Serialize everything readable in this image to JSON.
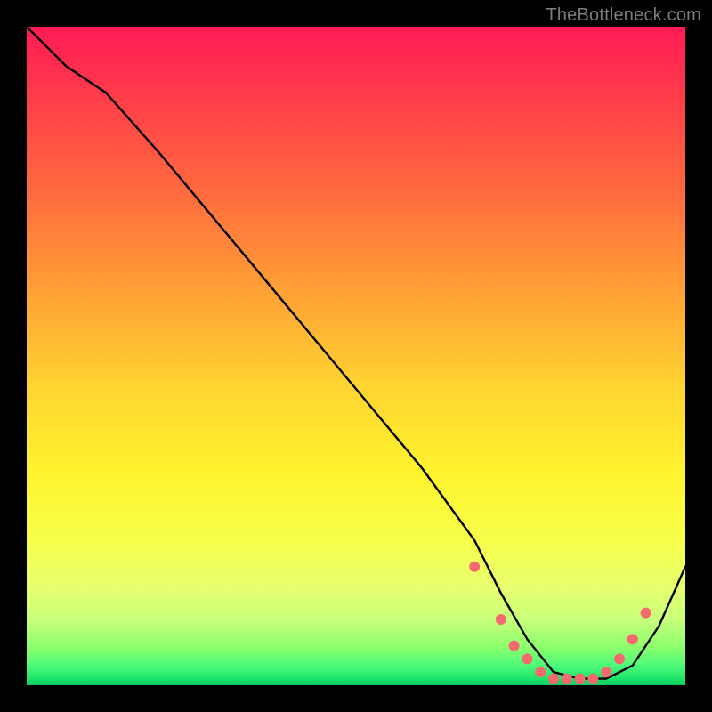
{
  "watermark": "TheBottleneck.com",
  "chart_data": {
    "type": "line",
    "title": "",
    "xlabel": "",
    "ylabel": "",
    "xlim": [
      0,
      100
    ],
    "ylim": [
      0,
      100
    ],
    "series": [
      {
        "name": "bottleneck-curve",
        "x": [
          0,
          6,
          12,
          20,
          30,
          40,
          50,
          60,
          68,
          72,
          76,
          80,
          84,
          88,
          92,
          96,
          100
        ],
        "y": [
          100,
          94,
          90,
          81,
          69,
          57,
          45,
          33,
          22,
          14,
          7,
          2,
          1,
          1,
          3,
          9,
          18
        ]
      }
    ],
    "highlight_points": {
      "name": "optimal-zone-markers",
      "x": [
        68,
        72,
        74,
        76,
        78,
        80,
        82,
        84,
        86,
        88,
        90,
        92,
        94
      ],
      "y": [
        18,
        10,
        6,
        4,
        2,
        1,
        1,
        1,
        1,
        2,
        4,
        7,
        11
      ]
    },
    "colors": {
      "curve": "#000000",
      "marker": "#f46a6e",
      "gradient_top": "#ff1a56",
      "gradient_mid": "#ffe833",
      "gradient_bottom": "#0cc85c"
    }
  }
}
